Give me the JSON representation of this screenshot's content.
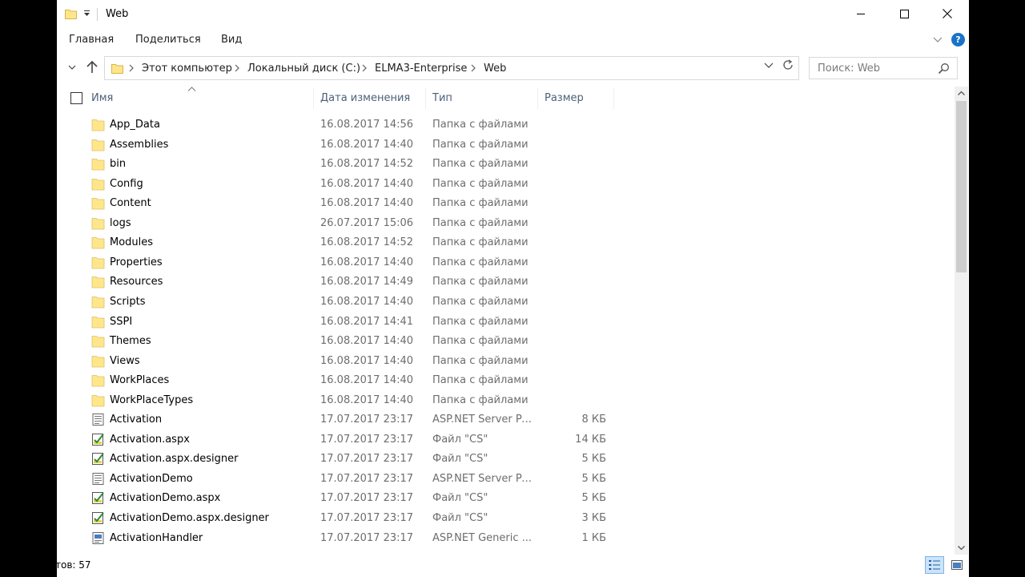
{
  "window": {
    "title": "Web"
  },
  "ribbon": {
    "tabs": [
      "Главная",
      "Поделиться",
      "Вид"
    ]
  },
  "address": {
    "crumbs": [
      "Этот компьютер",
      "Локальный диск (C:)",
      "ELMA3-Enterprise",
      "Web"
    ]
  },
  "search": {
    "placeholder": "Поиск: Web"
  },
  "columns": {
    "name": "Имя",
    "date": "Дата изменения",
    "type": "Тип",
    "size": "Размер"
  },
  "files": [
    {
      "name": "App_Data",
      "date": "16.08.2017 14:56",
      "type": "Папка с файлами",
      "size": "",
      "icon": "folder"
    },
    {
      "name": "Assemblies",
      "date": "16.08.2017 14:40",
      "type": "Папка с файлами",
      "size": "",
      "icon": "folder"
    },
    {
      "name": "bin",
      "date": "16.08.2017 14:52",
      "type": "Папка с файлами",
      "size": "",
      "icon": "folder"
    },
    {
      "name": "Config",
      "date": "16.08.2017 14:40",
      "type": "Папка с файлами",
      "size": "",
      "icon": "folder"
    },
    {
      "name": "Content",
      "date": "16.08.2017 14:40",
      "type": "Папка с файлами",
      "size": "",
      "icon": "folder"
    },
    {
      "name": "logs",
      "date": "26.07.2017 15:06",
      "type": "Папка с файлами",
      "size": "",
      "icon": "folder"
    },
    {
      "name": "Modules",
      "date": "16.08.2017 14:52",
      "type": "Папка с файлами",
      "size": "",
      "icon": "folder"
    },
    {
      "name": "Properties",
      "date": "16.08.2017 14:40",
      "type": "Папка с файлами",
      "size": "",
      "icon": "folder"
    },
    {
      "name": "Resources",
      "date": "16.08.2017 14:49",
      "type": "Папка с файлами",
      "size": "",
      "icon": "folder"
    },
    {
      "name": "Scripts",
      "date": "16.08.2017 14:40",
      "type": "Папка с файлами",
      "size": "",
      "icon": "folder"
    },
    {
      "name": "SSPI",
      "date": "16.08.2017 14:41",
      "type": "Папка с файлами",
      "size": "",
      "icon": "folder"
    },
    {
      "name": "Themes",
      "date": "16.08.2017 14:40",
      "type": "Папка с файлами",
      "size": "",
      "icon": "folder"
    },
    {
      "name": "Views",
      "date": "16.08.2017 14:40",
      "type": "Папка с файлами",
      "size": "",
      "icon": "folder"
    },
    {
      "name": "WorkPlaces",
      "date": "16.08.2017 14:40",
      "type": "Папка с файлами",
      "size": "",
      "icon": "folder"
    },
    {
      "name": "WorkPlaceTypes",
      "date": "16.08.2017 14:40",
      "type": "Папка с файлами",
      "size": "",
      "icon": "folder"
    },
    {
      "name": "Activation",
      "date": "17.07.2017 23:17",
      "type": "ASP.NET Server Pa...",
      "size": "8 КБ",
      "icon": "aspx"
    },
    {
      "name": "Activation.aspx",
      "date": "17.07.2017 23:17",
      "type": "Файл \"CS\"",
      "size": "14 КБ",
      "icon": "cs"
    },
    {
      "name": "Activation.aspx.designer",
      "date": "17.07.2017 23:17",
      "type": "Файл \"CS\"",
      "size": "5 КБ",
      "icon": "cs"
    },
    {
      "name": "ActivationDemo",
      "date": "17.07.2017 23:17",
      "type": "ASP.NET Server Pa...",
      "size": "5 КБ",
      "icon": "aspx"
    },
    {
      "name": "ActivationDemo.aspx",
      "date": "17.07.2017 23:17",
      "type": "Файл \"CS\"",
      "size": "5 КБ",
      "icon": "cs"
    },
    {
      "name": "ActivationDemo.aspx.designer",
      "date": "17.07.2017 23:17",
      "type": "Файл \"CS\"",
      "size": "3 КБ",
      "icon": "cs"
    },
    {
      "name": "ActivationHandler",
      "date": "17.07.2017 23:17",
      "type": "ASP.NET Generic ...",
      "size": "1 КБ",
      "icon": "ashx"
    }
  ],
  "status": {
    "count": "тов: 57"
  },
  "colors": {
    "folder": "#ffe68a",
    "accent": "#1a73c8",
    "header_text": "#4c607a",
    "secondary_text": "#6d6d6d"
  }
}
